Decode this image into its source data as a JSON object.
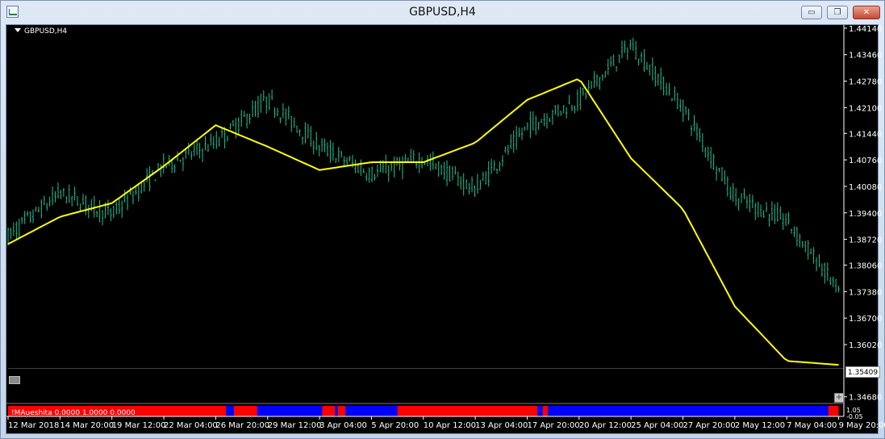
{
  "window": {
    "title": "GBPUSD,H4",
    "minimize_glyph": "▭",
    "restore_glyph": "❐",
    "close_glyph": "✕"
  },
  "chart_label": "GBPUSD,H4",
  "indicator_label": "!MAueshita 0.0000 1.0000 0.0000",
  "indicator_scale": [
    "1.05",
    "-0.05"
  ],
  "current_price": "1.35409",
  "colors": {
    "background": "#000000",
    "candle": "#20c090",
    "ma": "#ffff00",
    "ind_up": "#ff0000",
    "ind_down": "#0000ff",
    "axis_text": "#ffffff"
  },
  "chart_data": {
    "type": "line",
    "title": "GBPUSD,H4",
    "y_ticks": [
      "1.44140",
      "1.43460",
      "1.42780",
      "1.42100",
      "1.41440",
      "1.40760",
      "1.40080",
      "1.39400",
      "1.38720",
      "1.38060",
      "1.37380",
      "1.36700",
      "1.36020",
      "1.35409",
      "1.34680"
    ],
    "y_tick_values": [
      1.4414,
      1.4346,
      1.4278,
      1.421,
      1.4144,
      1.4076,
      1.4008,
      1.394,
      1.3872,
      1.3806,
      1.3738,
      1.367,
      1.3602,
      1.3541,
      1.3468
    ],
    "x_ticks": [
      "12 Mar 2018",
      "14 Mar 20:00",
      "19 Mar 12:00",
      "22 Mar 04:00",
      "26 Mar 20:00",
      "29 Mar 12:00",
      "3 Apr 04:00",
      "5 Apr 20:00",
      "10 Apr 12:00",
      "13 Apr 04:00",
      "17 Apr 20:00",
      "20 Apr 12:00",
      "25 Apr 04:00",
      "27 Apr 20:00",
      "2 May 12:00",
      "7 May 04:00",
      "9 May 20:00"
    ],
    "ylim": [
      1.3455,
      1.442
    ],
    "series": [
      {
        "kind": "price",
        "x": [
          0,
          1,
          2,
          3,
          4,
          5,
          6,
          7,
          8,
          9,
          10,
          11,
          12,
          13,
          14,
          15,
          16
        ],
        "values": [
          1.388,
          1.399,
          1.3935,
          1.406,
          1.412,
          1.423,
          1.411,
          1.404,
          1.408,
          1.4,
          1.416,
          1.423,
          1.437,
          1.421,
          1.398,
          1.392,
          1.374
        ]
      },
      {
        "kind": "ma",
        "x": [
          0,
          1,
          2,
          3,
          4,
          5,
          6,
          7,
          8,
          9,
          10,
          11,
          12,
          13,
          14,
          15,
          16
        ],
        "values": [
          1.386,
          1.393,
          1.3965,
          1.406,
          1.4165,
          1.411,
          1.405,
          1.407,
          1.407,
          1.412,
          1.423,
          1.4285,
          1.408,
          1.395,
          1.37,
          1.356,
          1.355
        ]
      }
    ],
    "indicator_segments": [
      {
        "state": "red",
        "from": 0,
        "to": 4.2
      },
      {
        "state": "blue",
        "from": 4.2,
        "to": 4.35
      },
      {
        "state": "red",
        "from": 4.35,
        "to": 4.8
      },
      {
        "state": "blue",
        "from": 4.8,
        "to": 6.05
      },
      {
        "state": "red",
        "from": 6.05,
        "to": 6.3
      },
      {
        "state": "blue",
        "from": 6.3,
        "to": 6.35
      },
      {
        "state": "red",
        "from": 6.35,
        "to": 6.5
      },
      {
        "state": "blue",
        "from": 6.5,
        "to": 7.5
      },
      {
        "state": "red",
        "from": 7.5,
        "to": 10.2
      },
      {
        "state": "blue",
        "from": 10.2,
        "to": 10.3
      },
      {
        "state": "red",
        "from": 10.3,
        "to": 10.4
      },
      {
        "state": "blue",
        "from": 10.4,
        "to": 15.8
      },
      {
        "state": "red",
        "from": 15.8,
        "to": 16
      }
    ]
  }
}
